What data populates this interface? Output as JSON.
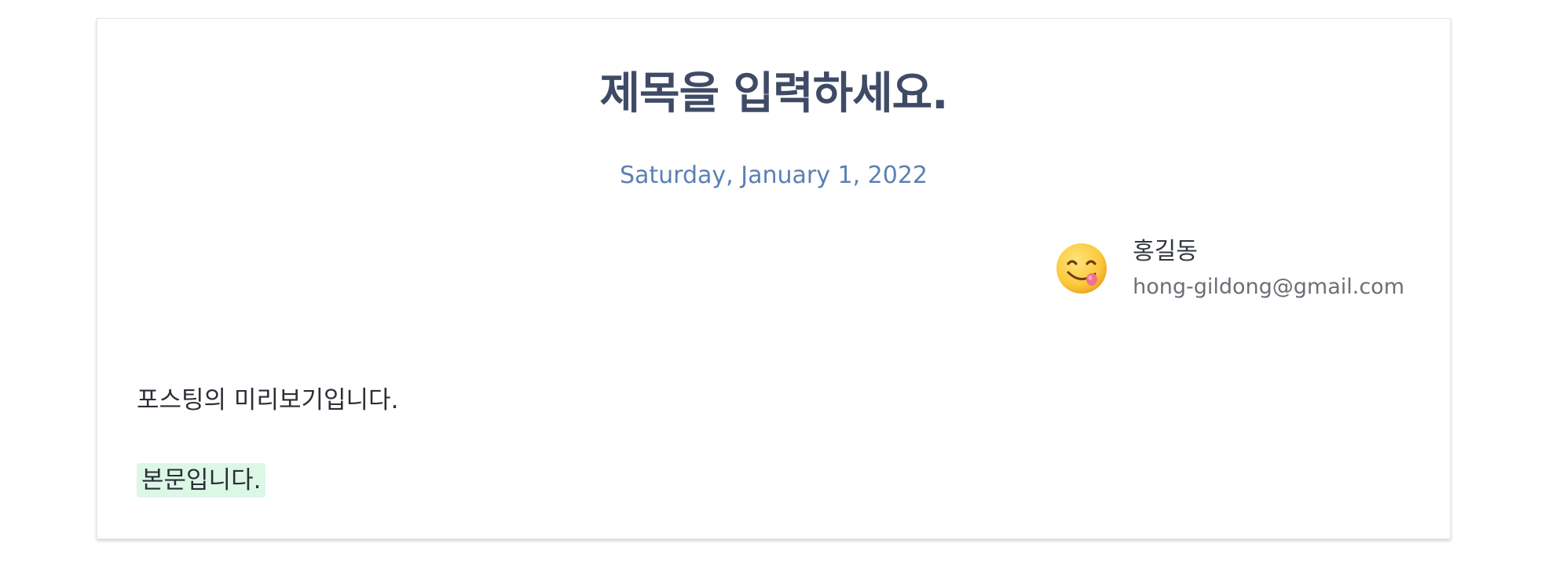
{
  "post": {
    "title": "제목을 입력하세요.",
    "date": "Saturday, January 1, 2022",
    "preview": "포스팅의 미리보기입니다.",
    "body": "본문입니다."
  },
  "author": {
    "avatar_icon": "savoring-face-emoji-icon",
    "name": "홍길동",
    "email": "hong-gildong@gmail.com"
  },
  "colors": {
    "title": "#3f4b66",
    "date": "#5b80b6",
    "highlight": "#ddf7e6"
  }
}
